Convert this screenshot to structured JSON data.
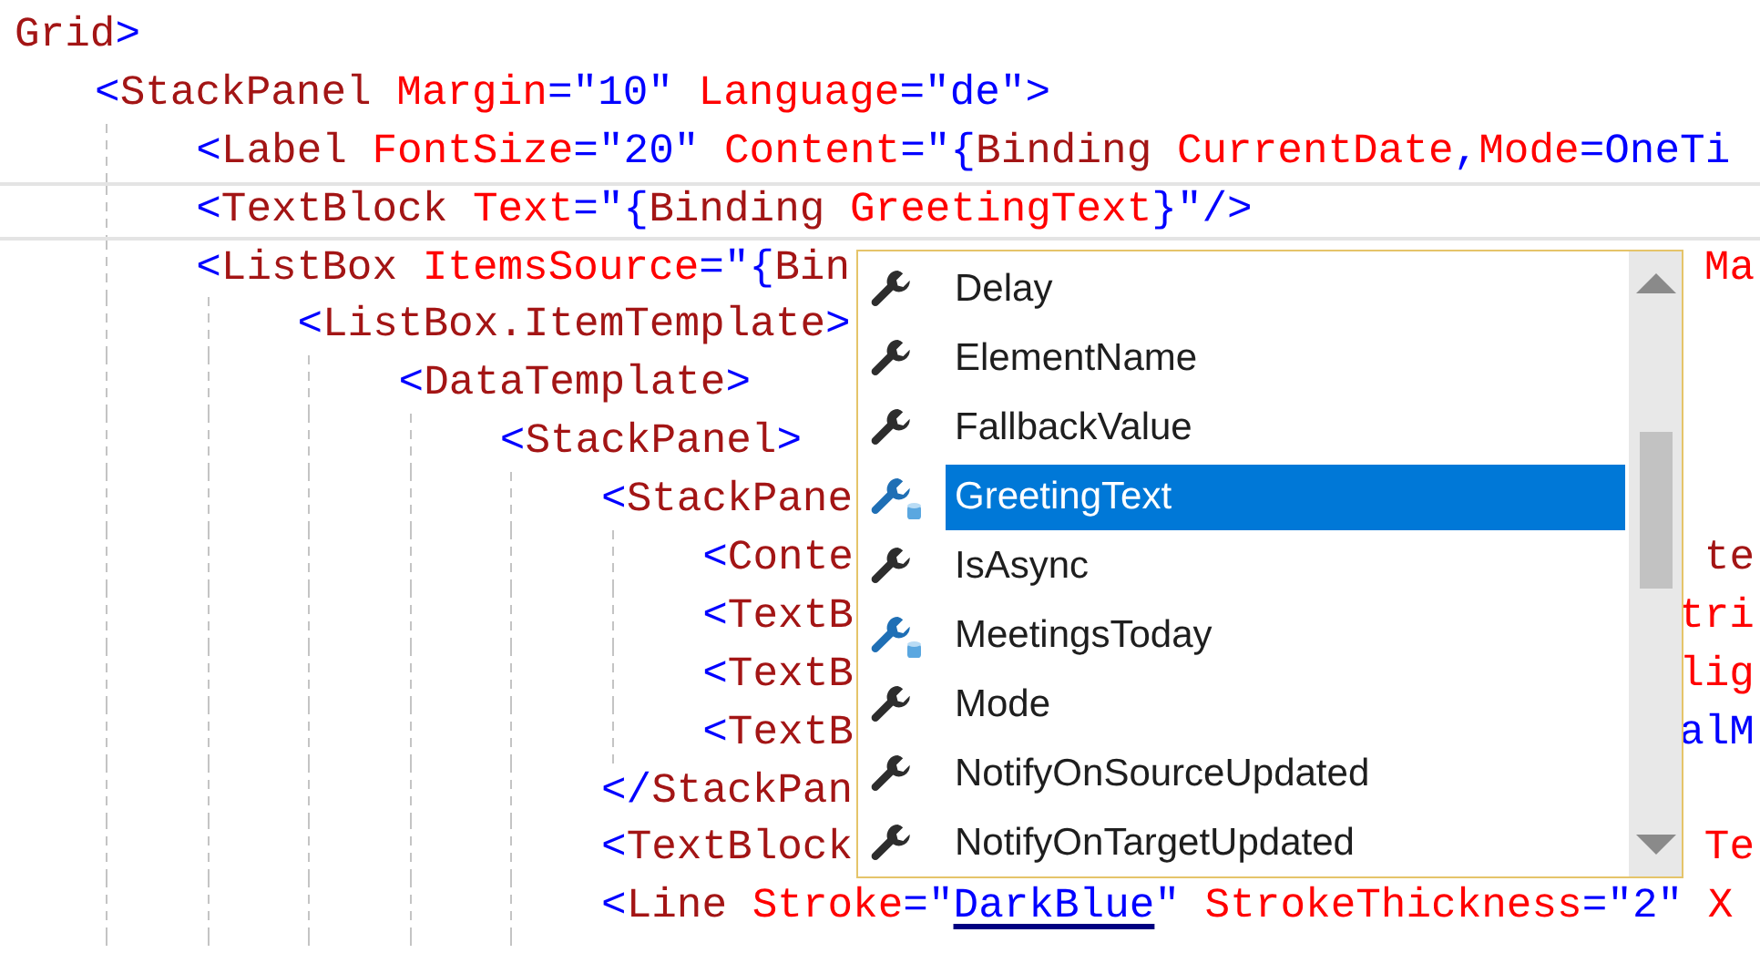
{
  "editor": {
    "lines": [
      {
        "current": false,
        "tokens": [
          {
            "kind": "element",
            "text": "Grid"
          },
          {
            "kind": "punct",
            "text": ">"
          }
        ],
        "children": [
          {
            "current": false,
            "tokens": [
              {
                "kind": "punct",
                "text": "<"
              },
              {
                "kind": "element",
                "text": "StackPanel"
              },
              {
                "kind": "attribute",
                "text": " Margin"
              },
              {
                "kind": "punct",
                "text": "=\"10\""
              },
              {
                "kind": "attribute",
                "text": " Language"
              },
              {
                "kind": "punct",
                "text": "=\"de\">"
              }
            ],
            "children": [
              {
                "current": false,
                "tokens": [
                  {
                    "kind": "punct",
                    "text": "<"
                  },
                  {
                    "kind": "element",
                    "text": "Label"
                  },
                  {
                    "kind": "attribute",
                    "text": " FontSize"
                  },
                  {
                    "kind": "punct",
                    "text": "=\"20\""
                  },
                  {
                    "kind": "attribute",
                    "text": " Content"
                  },
                  {
                    "kind": "punct",
                    "text": "=\"{"
                  },
                  {
                    "kind": "element",
                    "text": "Binding"
                  },
                  {
                    "kind": "attribute",
                    "text": " CurrentDate"
                  },
                  {
                    "kind": "punct",
                    "text": ","
                  },
                  {
                    "kind": "attribute",
                    "text": "Mode"
                  },
                  {
                    "kind": "punct",
                    "text": "=OneTi"
                  }
                ]
              },
              {
                "current": true,
                "tokens": [
                  {
                    "kind": "punct",
                    "text": "<"
                  },
                  {
                    "kind": "element",
                    "text": "TextBlock"
                  },
                  {
                    "kind": "attribute",
                    "text": " Text"
                  },
                  {
                    "kind": "punct",
                    "text": "=\"{"
                  },
                  {
                    "kind": "element",
                    "text": "Binding"
                  },
                  {
                    "kind": "attribute",
                    "text": " GreetingText"
                  },
                  {
                    "kind": "punct",
                    "text": "}\"/>"
                  }
                ]
              },
              {
                "current": false,
                "tokens": [
                  {
                    "kind": "punct",
                    "text": "<"
                  },
                  {
                    "kind": "element",
                    "text": "ListBox"
                  },
                  {
                    "kind": "attribute",
                    "text": " ItemsSource"
                  },
                  {
                    "kind": "punct",
                    "text": "=\"{"
                  },
                  {
                    "kind": "element",
                    "text": "Bin"
                  }
                ],
                "tail": [
                  {
                    "kind": "attribute",
                    "text": "Ma"
                  }
                ],
                "children": [
                  {
                    "current": false,
                    "tokens": [
                      {
                        "kind": "punct",
                        "text": "<"
                      },
                      {
                        "kind": "element",
                        "text": "ListBox.ItemTemplate"
                      },
                      {
                        "kind": "punct",
                        "text": ">"
                      }
                    ],
                    "children": [
                      {
                        "current": false,
                        "tokens": [
                          {
                            "kind": "punct",
                            "text": "<"
                          },
                          {
                            "kind": "element",
                            "text": "DataTemplate"
                          },
                          {
                            "kind": "punct",
                            "text": ">"
                          }
                        ],
                        "children": [
                          {
                            "current": false,
                            "tokens": [
                              {
                                "kind": "punct",
                                "text": "<"
                              },
                              {
                                "kind": "element",
                                "text": "StackPanel"
                              },
                              {
                                "kind": "punct",
                                "text": ">"
                              }
                            ],
                            "children": [
                              {
                                "current": false,
                                "tokens": [
                                  {
                                    "kind": "punct",
                                    "text": "<"
                                  },
                                  {
                                    "kind": "element",
                                    "text": "StackPane"
                                  }
                                ],
                                "children": [
                                  {
                                    "current": false,
                                    "tokens": [
                                      {
                                        "kind": "punct",
                                        "text": "<"
                                      },
                                      {
                                        "kind": "element",
                                        "text": "Conte"
                                      }
                                    ],
                                    "tail": [
                                      {
                                        "kind": "element",
                                        "text": "te"
                                      }
                                    ]
                                  },
                                  {
                                    "current": false,
                                    "tokens": [
                                      {
                                        "kind": "punct",
                                        "text": "<"
                                      },
                                      {
                                        "kind": "element",
                                        "text": "TextB"
                                      }
                                    ],
                                    "tail": [
                                      {
                                        "kind": "attribute",
                                        "text": "tri"
                                      }
                                    ]
                                  },
                                  {
                                    "current": false,
                                    "tokens": [
                                      {
                                        "kind": "punct",
                                        "text": "<"
                                      },
                                      {
                                        "kind": "element",
                                        "text": "TextB"
                                      }
                                    ],
                                    "tail": [
                                      {
                                        "kind": "attribute",
                                        "text": "lig"
                                      }
                                    ]
                                  },
                                  {
                                    "current": false,
                                    "tokens": [
                                      {
                                        "kind": "punct",
                                        "text": "<"
                                      },
                                      {
                                        "kind": "element",
                                        "text": "TextB"
                                      }
                                    ],
                                    "tail": [
                                      {
                                        "kind": "punct",
                                        "text": "alM"
                                      }
                                    ]
                                  }
                                ]
                              },
                              {
                                "current": false,
                                "tokens": [
                                  {
                                    "kind": "punct",
                                    "text": "</"
                                  },
                                  {
                                    "kind": "element",
                                    "text": "StackPan"
                                  }
                                ]
                              },
                              {
                                "current": false,
                                "tokens": [
                                  {
                                    "kind": "punct",
                                    "text": "<"
                                  },
                                  {
                                    "kind": "element",
                                    "text": "TextBlock"
                                  }
                                ],
                                "tail": [
                                  {
                                    "kind": "attribute",
                                    "text": "Te"
                                  }
                                ]
                              },
                              {
                                "current": false,
                                "tokens": [
                                  {
                                    "kind": "punct",
                                    "text": "<"
                                  },
                                  {
                                    "kind": "element",
                                    "text": "Line"
                                  },
                                  {
                                    "kind": "attribute",
                                    "text": " Stroke"
                                  },
                                  {
                                    "kind": "punct",
                                    "text": "=\""
                                  },
                                  {
                                    "kind": "link",
                                    "text": "DarkBlue"
                                  },
                                  {
                                    "kind": "punct",
                                    "text": "\""
                                  },
                                  {
                                    "kind": "attribute",
                                    "text": " StrokeThickness"
                                  },
                                  {
                                    "kind": "punct",
                                    "text": "=\"2\""
                                  },
                                  {
                                    "kind": "attribute",
                                    "text": " X"
                                  }
                                ]
                              }
                            ]
                          }
                        ]
                      }
                    ]
                  }
                ]
              }
            ]
          }
        ]
      }
    ]
  },
  "completion": {
    "items": [
      {
        "label": "Delay",
        "kind": "property",
        "selected": false
      },
      {
        "label": "ElementName",
        "kind": "property",
        "selected": false
      },
      {
        "label": "FallbackValue",
        "kind": "property",
        "selected": false
      },
      {
        "label": "GreetingText",
        "kind": "data-property",
        "selected": true
      },
      {
        "label": "IsAsync",
        "kind": "property",
        "selected": false
      },
      {
        "label": "MeetingsToday",
        "kind": "data-property",
        "selected": false
      },
      {
        "label": "Mode",
        "kind": "property",
        "selected": false
      },
      {
        "label": "NotifyOnSourceUpdated",
        "kind": "property",
        "selected": false
      },
      {
        "label": "NotifyOnTargetUpdated",
        "kind": "property",
        "selected": false
      }
    ]
  }
}
